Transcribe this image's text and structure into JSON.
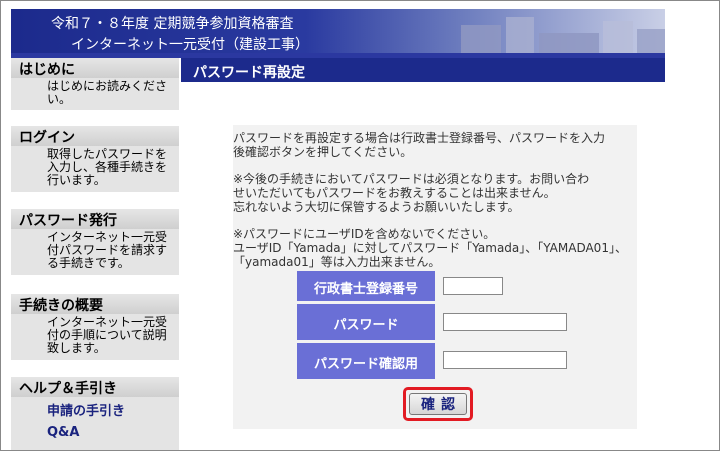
{
  "header": {
    "title_line1": "令和７・８年度 定期競争参加資格審査",
    "title_line2": "インターネット一元受付（建設工事）"
  },
  "sidebar": {
    "sections": [
      {
        "title": "はじめに",
        "desc": "はじめにお読みください。"
      },
      {
        "title": "ログイン",
        "desc": "取得したパスワードを入力し、各種手続きを行います。"
      },
      {
        "title": "パスワード発行",
        "desc": "インターネット一元受付パスワードを請求する手続きです。"
      },
      {
        "title": "手続きの概要",
        "desc": "インターネット一元受付の手順について説明致します。"
      },
      {
        "title": "ヘルプ＆手引き",
        "links": [
          "申請の手引き",
          "Q&A"
        ]
      }
    ]
  },
  "main": {
    "page_title": "パスワード再設定",
    "intro_line1": "パスワードを再設定する場合は行政書士登録番号、パスワードを入力",
    "intro_line2": "後確認ボタンを押してください。",
    "note1_line1": "※今後の手続きにおいてパスワードは必須となります。お問い合わ",
    "note1_line2": "せいただいてもパスワードをお教えすることは出来ません。",
    "note1_line3": "忘れないよう大切に保管するようお願いいたします。",
    "note2_line1": "※パスワードにユーザIDを含めないでください。",
    "note2_line2": "ユーザID「Yamada」に対してパスワード「Yamada」、「YAMADA01」、",
    "note2_line3": "「yamada01」等は入力出来ません。"
  },
  "form": {
    "reg_number_label": "行政書士登録番号",
    "password_label": "パスワード",
    "password_confirm_label": "パスワード確認用",
    "reg_number_value": "",
    "password_value": "",
    "password_confirm_value": "",
    "confirm_button": "確認"
  },
  "colors": {
    "header_navy": "#1c2a8c",
    "label_purple": "#6a6fd6",
    "button_highlight_red": "#e21b23"
  }
}
